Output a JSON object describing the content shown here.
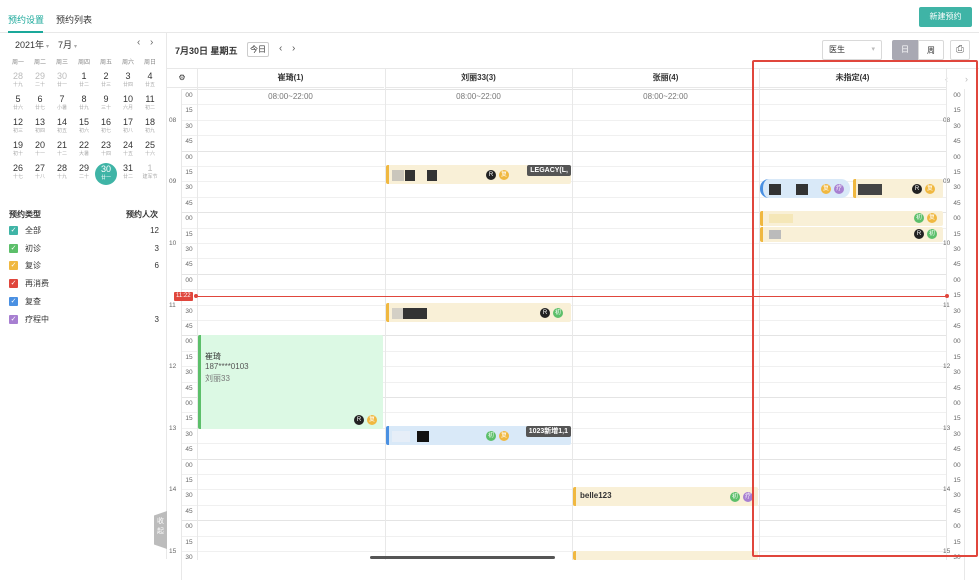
{
  "tabs": [
    "预约设置",
    "预约列表"
  ],
  "new_button": "新建预约",
  "calendar": {
    "year": "2021年",
    "month": "7月",
    "weekdays": [
      "周一",
      "周二",
      "周三",
      "周四",
      "周五",
      "周六",
      "周日"
    ],
    "weeks": [
      [
        [
          "28",
          "十九",
          1
        ],
        [
          "29",
          "二十",
          1
        ],
        [
          "30",
          "廿一",
          1
        ],
        [
          "1",
          "廿二",
          0
        ],
        [
          "2",
          "廿三",
          0
        ],
        [
          "3",
          "廿四",
          0
        ],
        [
          "4",
          "廿五",
          0
        ]
      ],
      [
        [
          "5",
          "廿六",
          0
        ],
        [
          "6",
          "廿七",
          0
        ],
        [
          "7",
          "小暑",
          0
        ],
        [
          "8",
          "廿九",
          0
        ],
        [
          "9",
          "三十",
          0
        ],
        [
          "10",
          "六月",
          0
        ],
        [
          "11",
          "初二",
          0
        ]
      ],
      [
        [
          "12",
          "初三",
          0
        ],
        [
          "13",
          "初四",
          0
        ],
        [
          "14",
          "初五",
          0
        ],
        [
          "15",
          "初六",
          0
        ],
        [
          "16",
          "初七",
          0
        ],
        [
          "17",
          "初八",
          0
        ],
        [
          "18",
          "初九",
          0
        ]
      ],
      [
        [
          "19",
          "初十",
          0
        ],
        [
          "20",
          "十一",
          0
        ],
        [
          "21",
          "十二",
          0
        ],
        [
          "22",
          "大暑",
          0
        ],
        [
          "23",
          "十四",
          0
        ],
        [
          "24",
          "十五",
          0
        ],
        [
          "25",
          "十六",
          0
        ]
      ],
      [
        [
          "26",
          "十七",
          0
        ],
        [
          "27",
          "十八",
          0
        ],
        [
          "28",
          "十九",
          0
        ],
        [
          "29",
          "二十",
          0
        ],
        [
          "30",
          "廿一",
          2
        ],
        [
          "31",
          "廿二",
          0
        ],
        [
          "1",
          "建军节",
          1
        ]
      ]
    ]
  },
  "legend": {
    "type_header": "预约类型",
    "count_header": "预约人次",
    "items": [
      {
        "label": "全部",
        "count": "12",
        "color": "#3fb4a6"
      },
      {
        "label": "初诊",
        "count": "3",
        "color": "#5cbf6a"
      },
      {
        "label": "复诊",
        "count": "6",
        "color": "#f0b840"
      },
      {
        "label": "再消费",
        "count": "",
        "color": "#e0463c"
      },
      {
        "label": "复查",
        "count": "",
        "color": "#4a90e2"
      },
      {
        "label": "疗程中",
        "count": "3",
        "color": "#a77fd1"
      }
    ]
  },
  "collapse": "收起",
  "toolbar": {
    "date": "7月30日 星期五",
    "today": "今日",
    "prev": "‹",
    "next": "›",
    "doctor_placeholder": "医生",
    "view_day": "日",
    "view_week": "周",
    "print_icon": "printer-icon"
  },
  "columns": [
    {
      "name": "崔琦(1)",
      "hours": "08:00~22:00"
    },
    {
      "name": "刘丽33(3)",
      "hours": "08:00~22:00"
    },
    {
      "name": "张丽(4)",
      "hours": "08:00~22:00"
    },
    {
      "name": "未指定(4)",
      "hours": ""
    }
  ],
  "hour_labels": [
    "08",
    "09",
    "10",
    "11",
    "12",
    "13",
    "14",
    "15"
  ],
  "minute_labels": [
    "00",
    "15",
    "30",
    "45"
  ],
  "now_time": "11:22",
  "appointments": {
    "liuli_0915_tag": "LEGACY(L,",
    "liuli_1330_tag": "1023新增1,1",
    "cuiqi_name": "崔琦",
    "cuiqi_phone": "187****0103",
    "cuiqi_doctor": "刘丽33",
    "zhangli_1415": "belle123"
  }
}
